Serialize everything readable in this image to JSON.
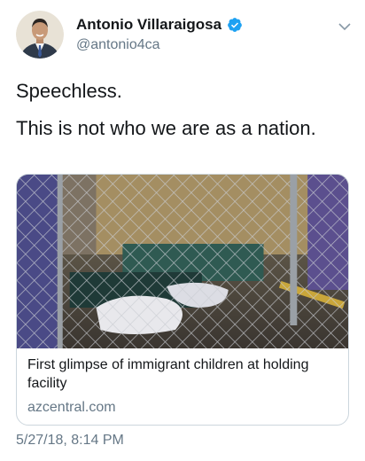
{
  "author": {
    "display_name": "Antonio Villaraigosa",
    "handle": "@antonio4ca"
  },
  "tweet": {
    "lines": [
      "Speechless.",
      "This is not who we are as a nation."
    ],
    "timestamp": "5/27/18, 8:14 PM"
  },
  "card": {
    "title": "First glimpse of immigrant children at holding facility",
    "domain": "azcentral.com"
  },
  "icons": {
    "verified": "verified-badge-icon",
    "menu": "chevron-down-icon"
  },
  "colors": {
    "verified_blue": "#1da1f2",
    "secondary_text": "#657786",
    "border": "#ccd6dd"
  }
}
